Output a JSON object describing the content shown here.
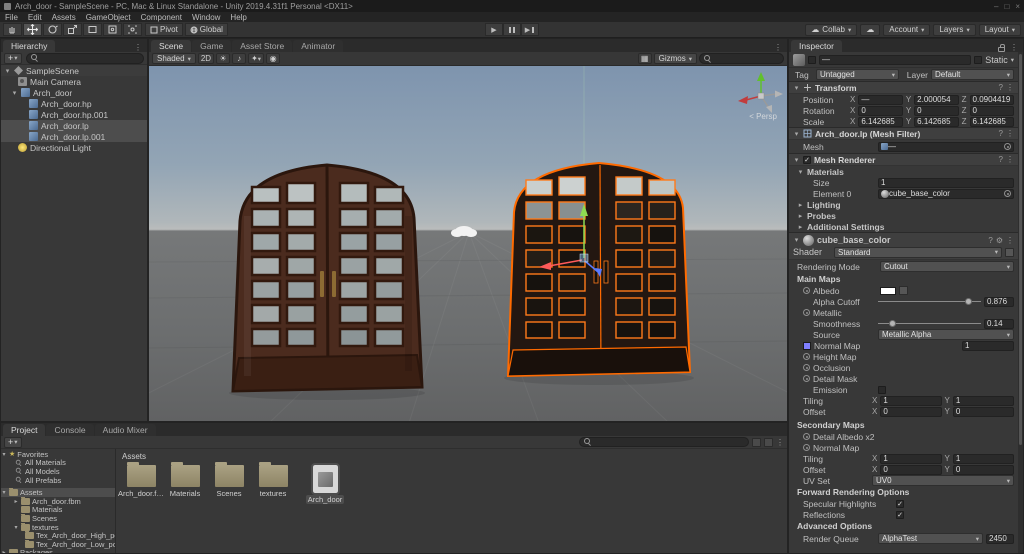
{
  "title_bar": {
    "title": "Arch_door - SampleScene - PC, Mac & Linux Standalone - Unity 2019.4.31f1 Personal <DX11>"
  },
  "menu_bar": {
    "items": [
      "File",
      "Edit",
      "Assets",
      "GameObject",
      "Component",
      "Window",
      "Help"
    ]
  },
  "toolbar": {
    "pivot": "Pivot",
    "global": "Global",
    "collab": "Collab",
    "account": "Account",
    "layers": "Layers",
    "layout": "Layout"
  },
  "colors": {
    "selection_outline": "#ff6a00"
  },
  "hierarchy": {
    "tab": "Hierarchy",
    "items": [
      {
        "label": "SampleScene"
      },
      {
        "label": "Main Camera"
      },
      {
        "label": "Arch_door"
      },
      {
        "label": "Arch_door.hp"
      },
      {
        "label": "Arch_door.hp.001"
      },
      {
        "label": "Arch_door.lp"
      },
      {
        "label": "Arch_door.lp.001"
      },
      {
        "label": "Directional Light"
      }
    ]
  },
  "scene_view": {
    "tabs": [
      "Scene",
      "Game",
      "Asset Store",
      "Animator"
    ],
    "shading_mode": "Shaded",
    "toggle_2d": "2D",
    "gizmos_label": "Gizmos",
    "camera_label": "< Persp"
  },
  "inspector": {
    "tab": "Inspector",
    "header": {
      "name": "—",
      "static_label": "Static"
    },
    "tag_label": "Tag",
    "tag_value": "Untagged",
    "layer_label": "Layer",
    "layer_value": "Default",
    "transform": {
      "title": "Transform",
      "position_label": "Position",
      "rotation_label": "Rotation",
      "scale_label": "Scale",
      "x_label": "X",
      "y_label": "Y",
      "z_label": "Z",
      "position": {
        "x": "—",
        "y": "2.000054",
        "z": "0.0904419"
      },
      "rotation": {
        "x": "0",
        "y": "0",
        "z": "0"
      },
      "scale": {
        "x": "6.142685",
        "y": "6.142685",
        "z": "6.142685"
      }
    },
    "mesh_filter": {
      "title": "Arch_door.lp (Mesh Filter)",
      "mesh_label": "Mesh",
      "mesh_value": "—"
    },
    "mesh_renderer": {
      "title": "Mesh Renderer",
      "materials_label": "Materials",
      "size_label": "Size",
      "size_value": "1",
      "element_label": "Element 0",
      "element_value": "cube_base_color",
      "lighting_label": "Lighting",
      "probes_label": "Probes",
      "additional_label": "Additional Settings"
    },
    "material": {
      "title": "cube_base_color",
      "shader_label": "Shader",
      "shader_value": "Standard",
      "rendering_mode_label": "Rendering Mode",
      "rendering_mode_value": "Cutout",
      "main_maps_label": "Main Maps",
      "albedo_label": "Albedo",
      "alpha_cutoff_label": "Alpha Cutoff",
      "alpha_cutoff_value": "0.876",
      "metallic_label": "Metallic",
      "smoothness_label": "Smoothness",
      "smoothness_value": "0.14",
      "source_label": "Source",
      "source_value": "Metallic Alpha",
      "normal_map_label": "Normal Map",
      "normal_map_value": "1",
      "height_map_label": "Height Map",
      "occlusion_label": "Occlusion",
      "detail_mask_label": "Detail Mask",
      "emission_label": "Emission",
      "tiling_label": "Tiling",
      "offset_label": "Offset",
      "main_tiling": {
        "x": "1",
        "y": "1"
      },
      "main_offset": {
        "x": "0",
        "y": "0"
      },
      "secondary_maps_label": "Secondary Maps",
      "detail_albedo_label": "Detail Albedo x2",
      "secondary_normal_label": "Normal Map",
      "secondary_tiling": {
        "x": "1",
        "y": "1"
      },
      "secondary_offset": {
        "x": "0",
        "y": "0"
      },
      "uv_set_label": "UV Set",
      "uv_set_value": "UV0",
      "forward_label": "Forward Rendering Options",
      "specular_label": "Specular Highlights",
      "reflections_label": "Reflections",
      "advanced_label": "Advanced Options",
      "render_queue_label": "Render Queue",
      "render_queue_value": "AlphaTest",
      "render_queue_number": "2450"
    }
  },
  "project": {
    "tabs": [
      "Project",
      "Console",
      "Audio Mixer"
    ],
    "favorites_label": "Favorites",
    "favorites": [
      "All Materials",
      "All Models",
      "All Prefabs"
    ],
    "assets_label": "Assets",
    "tree": [
      "Arch_door.fbm",
      "Materials",
      "Scenes",
      "textures"
    ],
    "textures_children": [
      "Tex_Arch_door_High_poly",
      "Tex_Arch_door_Low_poly"
    ],
    "packages_label": "Packages",
    "breadcrumb": "Assets",
    "items": [
      {
        "label": "Arch_door.fbm"
      },
      {
        "label": "Materials"
      },
      {
        "label": "Scenes"
      },
      {
        "label": "textures"
      },
      {
        "label": "Arch_door"
      }
    ]
  }
}
